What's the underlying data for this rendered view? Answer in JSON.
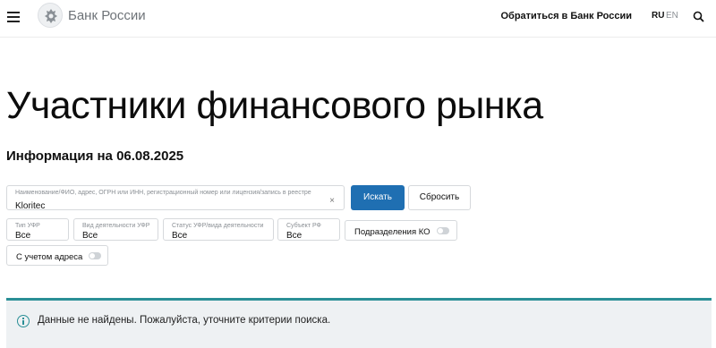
{
  "header": {
    "brand": "Банк России",
    "appeal_link": "Обратиться в Банк России",
    "lang_ru": "RU",
    "lang_en": "EN",
    "icons": [
      "menu-icon",
      "bank-emblem-icon",
      "search-icon"
    ]
  },
  "main": {
    "title": "Участники финансового рынка",
    "info_date": "Информация на 06.08.2025"
  },
  "search": {
    "label": "Наименование/ФИО, адрес, ОГРН или ИНН, регистрационный номер или лицензия/запись в реестре",
    "value": "Kloritec",
    "clear": "×",
    "search_button": "Искать",
    "reset_button": "Сбросить"
  },
  "filters": {
    "type": {
      "label": "Тип УФР",
      "value": "Все"
    },
    "activity": {
      "label": "Вид деятельности УФР",
      "value": "Все"
    },
    "status": {
      "label": "Статус УФР/вида деятельности",
      "value": "Все"
    },
    "region": {
      "label": "Субъект РФ",
      "value": "Все"
    },
    "branches_toggle": {
      "label": "Подразделения КО",
      "on": false
    },
    "address_toggle": {
      "label": "С учетом адреса",
      "on": false
    }
  },
  "notice": {
    "text": "Данные не найдены. Пожалуйста, уточните критерии поиска.",
    "accent_color": "#2a8f96"
  },
  "colors": {
    "primary_button": "#1f6fb2",
    "notice_background": "#eef1f3"
  }
}
